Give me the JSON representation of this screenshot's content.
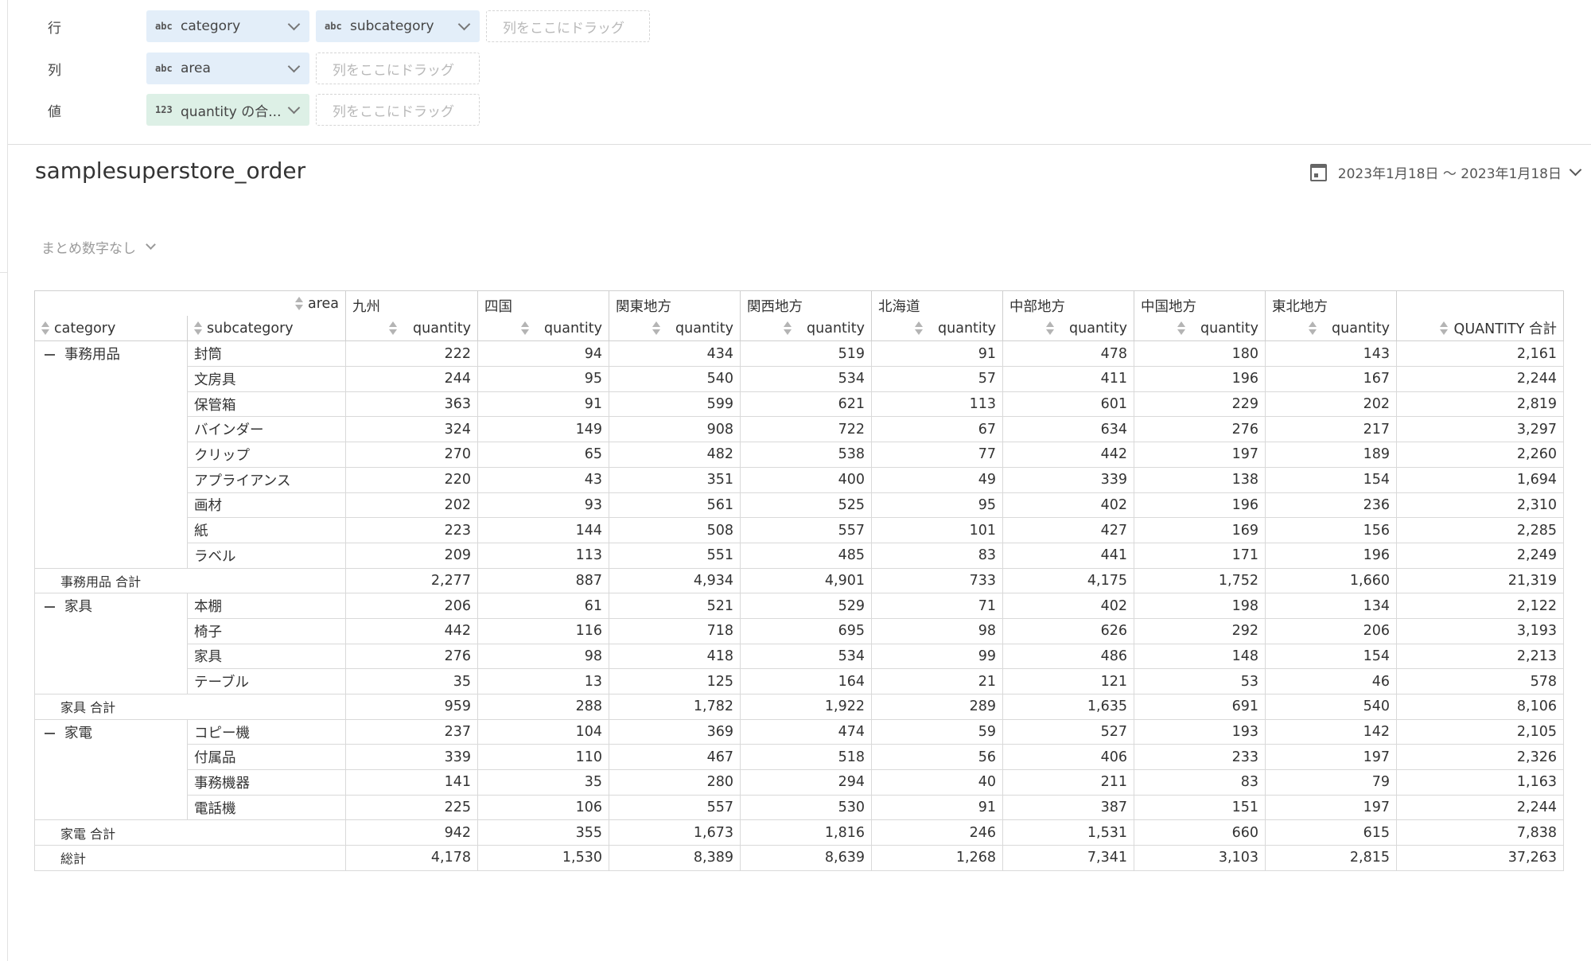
{
  "shelves": {
    "rows": {
      "label": "行",
      "pills": [
        {
          "type": "abc",
          "text": "category"
        },
        {
          "type": "abc",
          "text": "subcategory"
        }
      ],
      "drop": "列をここにドラッグ"
    },
    "columns": {
      "label": "列",
      "pills": [
        {
          "type": "abc",
          "text": "area"
        }
      ],
      "drop": "列をここにドラッグ"
    },
    "values": {
      "label": "値",
      "pills": [
        {
          "type": "123",
          "text": "quantity の合..."
        }
      ],
      "drop": "列をここにドラッグ"
    }
  },
  "report": {
    "title": "samplesuperstore_order",
    "date_range": "2023年1月18日 〜 2023年1月18日",
    "summary_option": "まとめ数字なし"
  },
  "colors": {
    "dimension_pill": "#e3eef9",
    "measure_pill": "#ddf0e6"
  },
  "table": {
    "header": {
      "column_dim": "area",
      "row_dims": [
        "category",
        "subcategory"
      ],
      "measure": "quantity",
      "total_label": "QUANTITY 合計"
    },
    "areas": [
      "九州",
      "四国",
      "関東地方",
      "関西地方",
      "北海道",
      "中部地方",
      "中国地方",
      "東北地方"
    ],
    "groups": [
      {
        "category": "事務用品",
        "rows": [
          {
            "sub": "封筒",
            "values": [
              "222",
              "94",
              "434",
              "519",
              "91",
              "478",
              "180",
              "143"
            ],
            "total": "2,161"
          },
          {
            "sub": "文房具",
            "values": [
              "244",
              "95",
              "540",
              "534",
              "57",
              "411",
              "196",
              "167"
            ],
            "total": "2,244"
          },
          {
            "sub": "保管箱",
            "values": [
              "363",
              "91",
              "599",
              "621",
              "113",
              "601",
              "229",
              "202"
            ],
            "total": "2,819"
          },
          {
            "sub": "バインダー",
            "values": [
              "324",
              "149",
              "908",
              "722",
              "67",
              "634",
              "276",
              "217"
            ],
            "total": "3,297"
          },
          {
            "sub": "クリップ",
            "values": [
              "270",
              "65",
              "482",
              "538",
              "77",
              "442",
              "197",
              "189"
            ],
            "total": "2,260"
          },
          {
            "sub": "アプライアンス",
            "values": [
              "220",
              "43",
              "351",
              "400",
              "49",
              "339",
              "138",
              "154"
            ],
            "total": "1,694"
          },
          {
            "sub": "画材",
            "values": [
              "202",
              "93",
              "561",
              "525",
              "95",
              "402",
              "196",
              "236"
            ],
            "total": "2,310"
          },
          {
            "sub": "紙",
            "values": [
              "223",
              "144",
              "508",
              "557",
              "101",
              "427",
              "169",
              "156"
            ],
            "total": "2,285"
          },
          {
            "sub": "ラベル",
            "values": [
              "209",
              "113",
              "551",
              "485",
              "83",
              "441",
              "171",
              "196"
            ],
            "total": "2,249"
          }
        ],
        "subtotal": {
          "label": "事務用品 合計",
          "values": [
            "2,277",
            "887",
            "4,934",
            "4,901",
            "733",
            "4,175",
            "1,752",
            "1,660"
          ],
          "total": "21,319"
        }
      },
      {
        "category": "家具",
        "rows": [
          {
            "sub": "本棚",
            "values": [
              "206",
              "61",
              "521",
              "529",
              "71",
              "402",
              "198",
              "134"
            ],
            "total": "2,122"
          },
          {
            "sub": "椅子",
            "values": [
              "442",
              "116",
              "718",
              "695",
              "98",
              "626",
              "292",
              "206"
            ],
            "total": "3,193"
          },
          {
            "sub": "家具",
            "values": [
              "276",
              "98",
              "418",
              "534",
              "99",
              "486",
              "148",
              "154"
            ],
            "total": "2,213"
          },
          {
            "sub": "テーブル",
            "values": [
              "35",
              "13",
              "125",
              "164",
              "21",
              "121",
              "53",
              "46"
            ],
            "total": "578"
          }
        ],
        "subtotal": {
          "label": "家具 合計",
          "values": [
            "959",
            "288",
            "1,782",
            "1,922",
            "289",
            "1,635",
            "691",
            "540"
          ],
          "total": "8,106"
        }
      },
      {
        "category": "家電",
        "rows": [
          {
            "sub": "コピー機",
            "values": [
              "237",
              "104",
              "369",
              "474",
              "59",
              "527",
              "193",
              "142"
            ],
            "total": "2,105"
          },
          {
            "sub": "付属品",
            "values": [
              "339",
              "110",
              "467",
              "518",
              "56",
              "406",
              "233",
              "197"
            ],
            "total": "2,326"
          },
          {
            "sub": "事務機器",
            "values": [
              "141",
              "35",
              "280",
              "294",
              "40",
              "211",
              "83",
              "79"
            ],
            "total": "1,163"
          },
          {
            "sub": "電話機",
            "values": [
              "225",
              "106",
              "557",
              "530",
              "91",
              "387",
              "151",
              "197"
            ],
            "total": "2,244"
          }
        ],
        "subtotal": {
          "label": "家電 合計",
          "values": [
            "942",
            "355",
            "1,673",
            "1,816",
            "246",
            "1,531",
            "660",
            "615"
          ],
          "total": "7,838"
        }
      }
    ],
    "grand_total": {
      "label": "総計",
      "values": [
        "4,178",
        "1,530",
        "8,389",
        "8,639",
        "1,268",
        "7,341",
        "3,103",
        "2,815"
      ],
      "total": "37,263"
    }
  }
}
